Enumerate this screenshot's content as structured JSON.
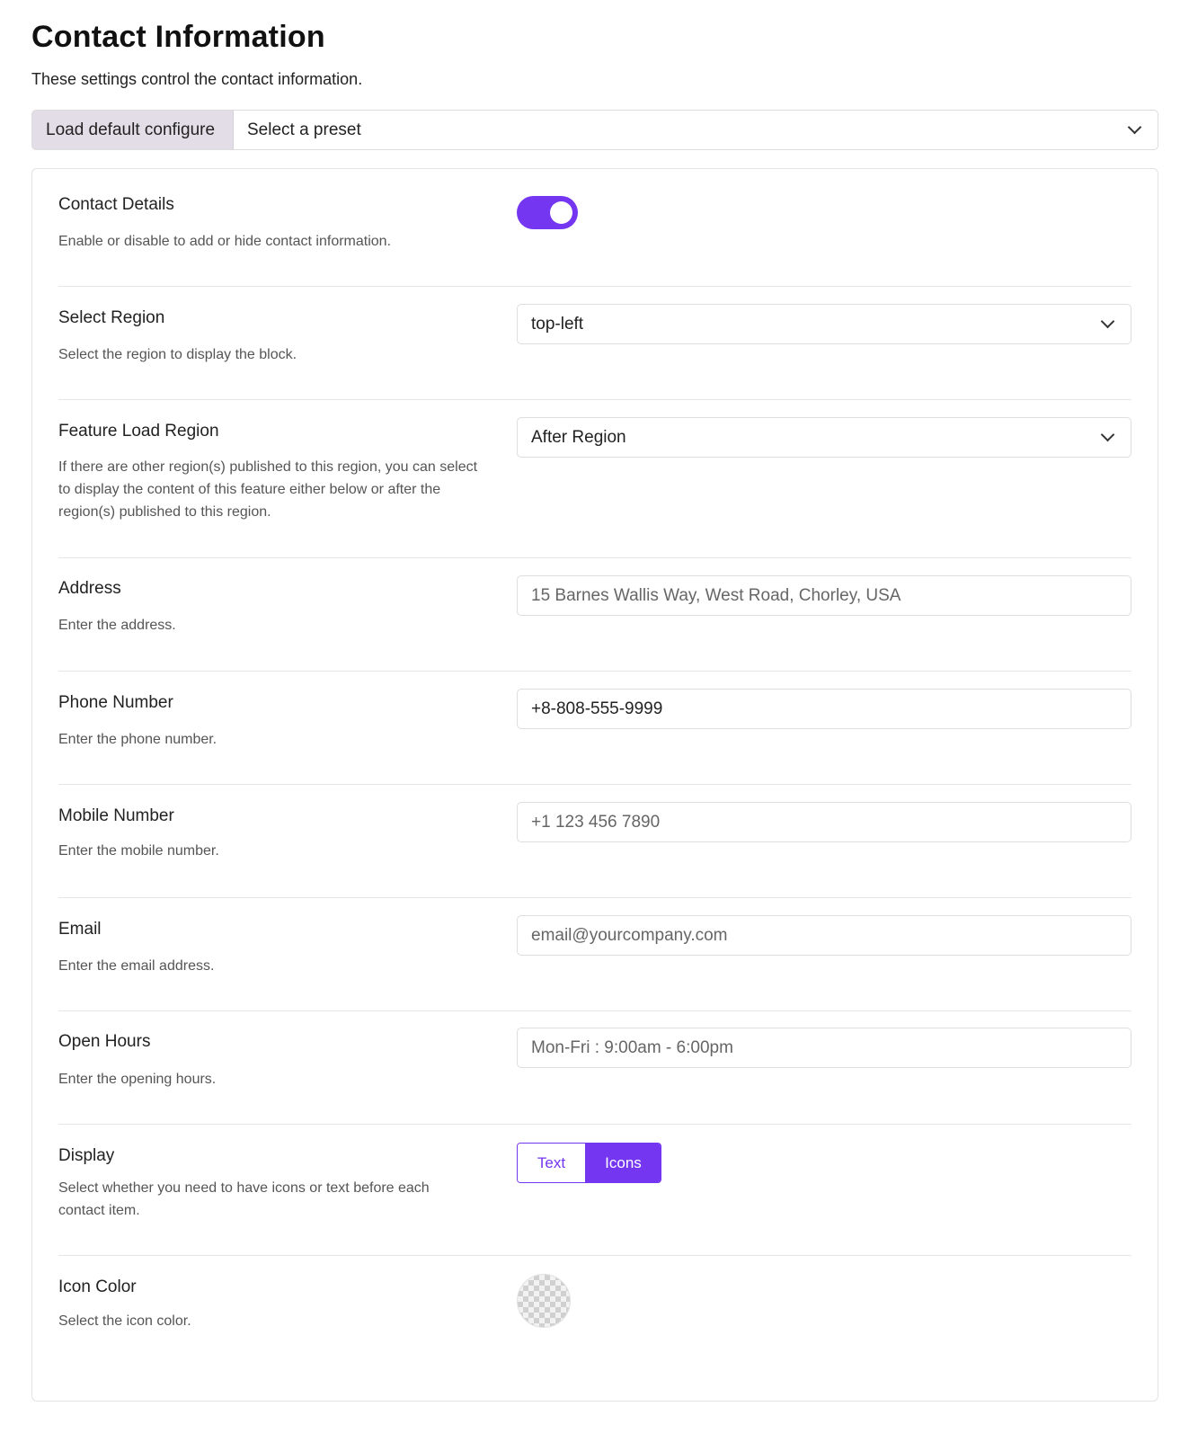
{
  "header": {
    "title": "Contact Information",
    "subtitle": "These settings control the contact information."
  },
  "preset": {
    "button_label": "Load default configure",
    "select_value": "Select a preset"
  },
  "settings": {
    "contact_details": {
      "label": "Contact Details",
      "description": "Enable or disable to add or hide contact information.",
      "enabled": true
    },
    "region": {
      "label": "Select Region",
      "description": "Select the region to display the block.",
      "value": "top-left"
    },
    "feature_load": {
      "label": "Feature Load Region",
      "description": "If there are other region(s) published to this region, you can select to display the content of this feature either below or after the region(s) published to this region.",
      "value": "After Region"
    },
    "address": {
      "label": "Address",
      "description": "Enter the address.",
      "value": "15 Barnes Wallis Way, West Road, Chorley, USA"
    },
    "phone": {
      "label": "Phone Number",
      "description": "Enter the phone number.",
      "value": "+8-808-555-9999"
    },
    "mobile": {
      "label": "Mobile Number",
      "description": "Enter the mobile number.",
      "value": "+1 123 456 7890"
    },
    "email": {
      "label": "Email",
      "description": "Enter the email address.",
      "value": "email@yourcompany.com"
    },
    "hours": {
      "label": "Open Hours",
      "description": "Enter the opening hours.",
      "value": "Mon-Fri : 9:00am - 6:00pm"
    },
    "display": {
      "label": "Display",
      "description": "Select whether you need to have icons or text before each contact item.",
      "options": [
        "Text",
        "Icons"
      ],
      "selected": "Icons"
    },
    "icon_color": {
      "label": "Icon Color",
      "description": "Select the icon color."
    }
  },
  "colors": {
    "accent": "#7436f0",
    "preset_label_bg": "#e2dde6"
  }
}
